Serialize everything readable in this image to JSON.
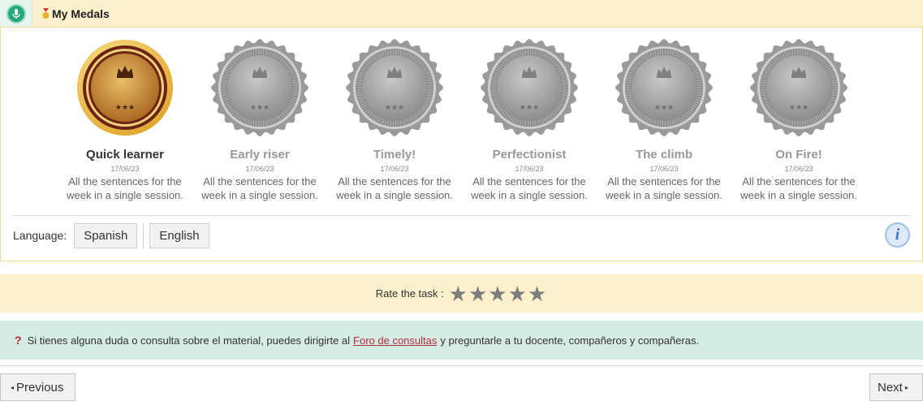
{
  "tabs": {
    "mic_icon": "microphone-icon",
    "medals_icon": "trophy-icon",
    "medals_label": "My Medals"
  },
  "colors": {
    "tab_background": "#fdf0cc",
    "mic_green": "#22a87a",
    "gold": "#e2b33d",
    "medal_grey": "#a9a9a9",
    "rating_band": "#fdf0cc",
    "help_band": "#d5ebe5",
    "link_red": "#b5303a"
  },
  "medals": [
    {
      "name": "Quick learner",
      "date": "17/06/23",
      "desc_line1": "All the sentences for the",
      "desc_line2": "week in a single session.",
      "earned": true
    },
    {
      "name": "Early riser",
      "date": "17/06/23",
      "desc_line1": "All the sentences for the",
      "desc_line2": "week in a single session.",
      "earned": false
    },
    {
      "name": "Timely!",
      "date": "17/06/23",
      "desc_line1": "All the sentences for the",
      "desc_line2": "week in a single session.",
      "earned": false
    },
    {
      "name": "Perfectionist",
      "date": "17/06/23",
      "desc_line1": "All the sentences for the",
      "desc_line2": "week in a single session.",
      "earned": false
    },
    {
      "name": "The climb",
      "date": "17/06/23",
      "desc_line1": "All the sentences for the",
      "desc_line2": "week in a single session.",
      "earned": false
    },
    {
      "name": "On Fire!",
      "date": "17/06/23",
      "desc_line1": "All the sentences for the",
      "desc_line2": "week in a single session.",
      "earned": false
    }
  ],
  "language": {
    "label": "Language:",
    "options": [
      "Spanish",
      "English"
    ],
    "info_icon": "info-icon",
    "info_glyph": "i"
  },
  "rating": {
    "label": "Rate the task :",
    "stars": 5,
    "star_glyph": "★"
  },
  "help": {
    "icon_glyph": "?",
    "text_before": "Si tienes alguna duda o consulta sobre el material, puedes dirigirte al",
    "link_text": "Foro de consultas",
    "text_after": "y preguntarle a tu docente, compañeros y compañeras."
  },
  "nav": {
    "previous_label": "Previous",
    "next_label": "Next",
    "prev_arrow": "◂",
    "next_arrow": "▸"
  }
}
